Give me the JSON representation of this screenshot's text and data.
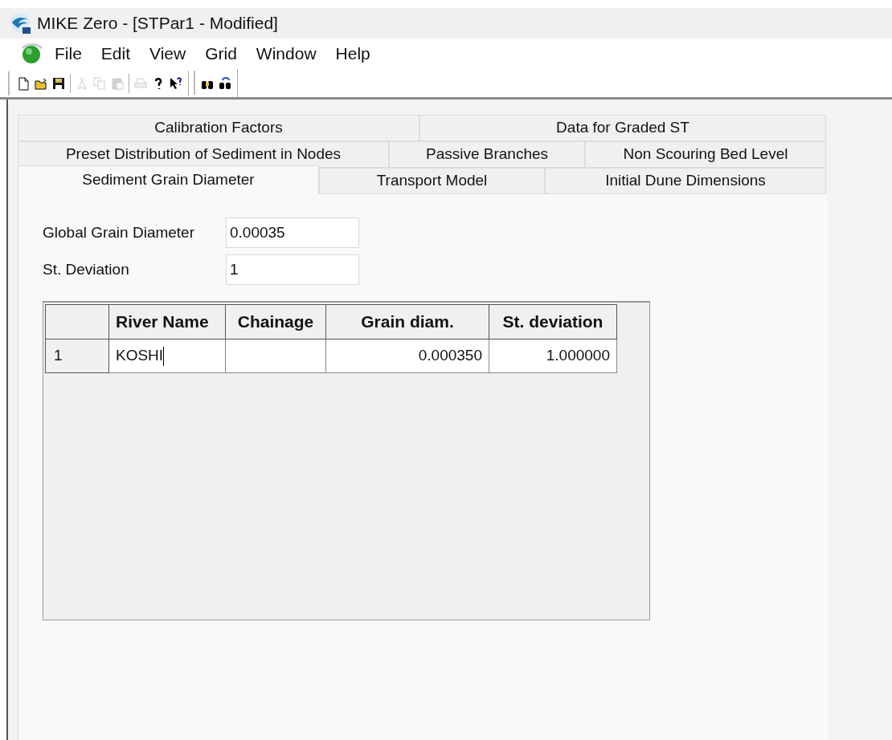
{
  "window": {
    "title": "MIKE Zero - [STPar1 - Modified]"
  },
  "menu": [
    "File",
    "Edit",
    "View",
    "Grid",
    "Window",
    "Help"
  ],
  "toolbar": [
    {
      "kind": "new",
      "disabled": false
    },
    {
      "kind": "open",
      "disabled": false
    },
    {
      "kind": "save",
      "disabled": false
    },
    {
      "kind": "sep"
    },
    {
      "kind": "cut",
      "disabled": true
    },
    {
      "kind": "copy",
      "disabled": true
    },
    {
      "kind": "paste",
      "disabled": true
    },
    {
      "kind": "sep"
    },
    {
      "kind": "print",
      "disabled": true
    },
    {
      "kind": "help",
      "disabled": false
    },
    {
      "kind": "context-help",
      "disabled": false
    },
    {
      "kind": "bar"
    },
    {
      "kind": "find",
      "disabled": false
    },
    {
      "kind": "replace",
      "disabled": false
    }
  ],
  "tab_rows": [
    [
      {
        "label": "Calibration Factors",
        "selected": false
      },
      {
        "label": "Data for Graded ST",
        "selected": false
      }
    ],
    [
      {
        "label": "Preset Distribution of Sediment in Nodes",
        "selected": false
      },
      {
        "label": "Passive Branches",
        "selected": false
      },
      {
        "label": "Non Scouring Bed Level",
        "selected": false
      }
    ],
    [
      {
        "label": "Sediment Grain Diameter",
        "selected": true
      },
      {
        "label": "Transport Model",
        "selected": false
      },
      {
        "label": "Initial Dune Dimensions",
        "selected": false
      }
    ]
  ],
  "fields": [
    {
      "label": "Global Grain Diameter",
      "value": "0.00035"
    },
    {
      "label": "St. Deviation",
      "value": "1"
    }
  ],
  "grid": {
    "columns": [
      "River Name",
      "Chainage",
      "Grain diam.",
      "St. deviation"
    ],
    "rows": [
      {
        "header": "1",
        "cells": [
          {
            "text": "KOSHI",
            "editing": true
          },
          {
            "text": "",
            "editing": false
          },
          {
            "text": "0.000350",
            "editing": false
          },
          {
            "text": "1.000000",
            "editing": false
          }
        ]
      }
    ]
  }
}
